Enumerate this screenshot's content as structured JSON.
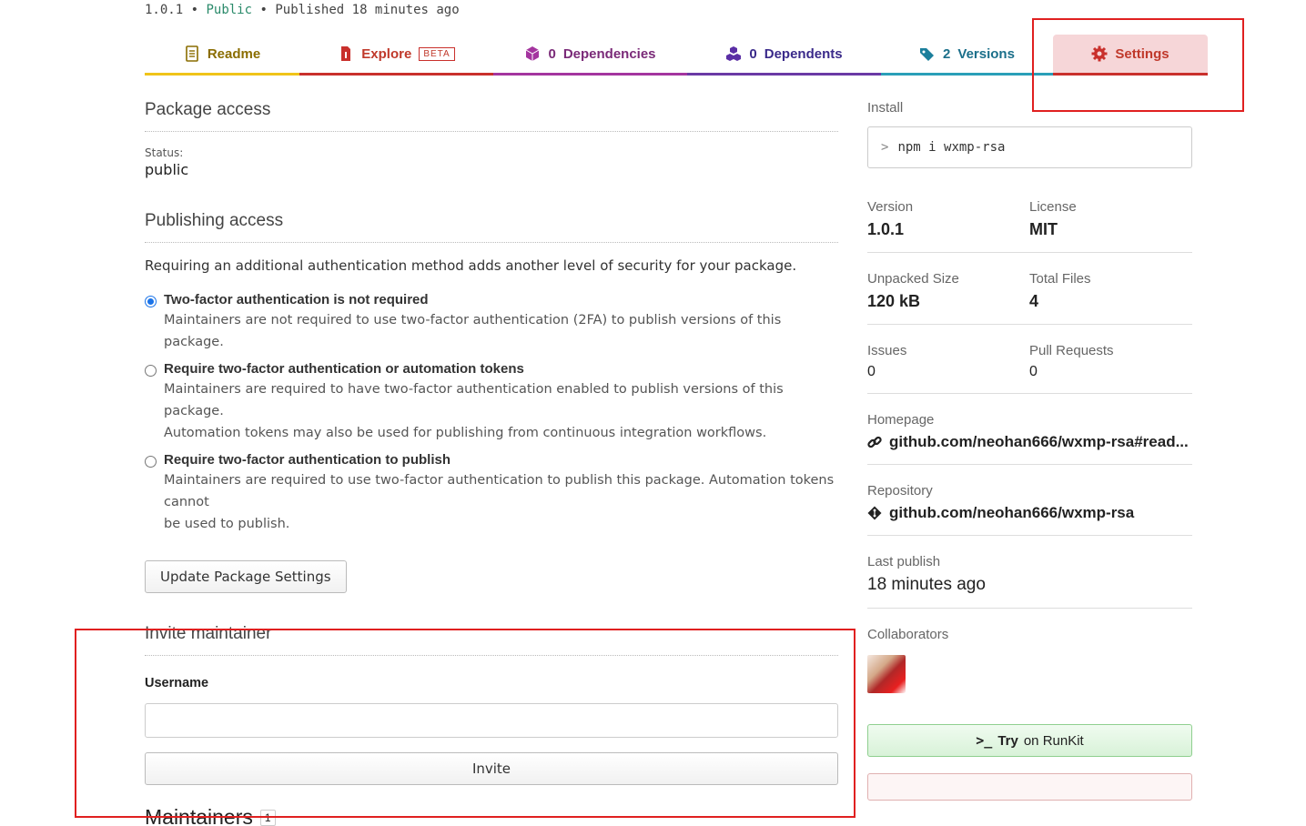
{
  "meta": {
    "version": "1.0.1",
    "visibility": "Public",
    "published": "Published 18 minutes ago",
    "sep": "•"
  },
  "tabs": {
    "readme": {
      "label": "Readme",
      "icon": "readme-icon"
    },
    "explore": {
      "label": "Explore",
      "badge": "BETA",
      "icon": "explore-icon"
    },
    "dependencies": {
      "count": "0",
      "label": "Dependencies",
      "icon": "box-icon"
    },
    "dependents": {
      "count": "0",
      "label": "Dependents",
      "icon": "boxes-icon"
    },
    "versions": {
      "count": "2",
      "label": "Versions",
      "icon": "tags-icon"
    },
    "settings": {
      "label": "Settings",
      "icon": "gear-icon"
    }
  },
  "package_access": {
    "title": "Package access",
    "status_label": "Status:",
    "status_value": "public"
  },
  "publishing_access": {
    "title": "Publishing access",
    "description": "Requiring an additional authentication method adds another level of security for your package.",
    "options": [
      {
        "title": "Two-factor authentication is not required",
        "desc": "Maintainers are not required to use two-factor authentication (2FA) to publish versions of this package.",
        "checked": true
      },
      {
        "title": "Require two-factor authentication or automation tokens",
        "desc": "Maintainers are required to have two-factor authentication enabled to publish versions of this package.",
        "desc2": "Automation tokens may also be used for publishing from continuous integration workflows.",
        "checked": false
      },
      {
        "title": "Require two-factor authentication to publish",
        "desc": "Maintainers are required to use two-factor authentication to publish this package. Automation tokens cannot",
        "desc2": "be used to publish.",
        "checked": false
      }
    ],
    "update_button": "Update Package Settings"
  },
  "invite": {
    "title": "Invite maintainer",
    "username_label": "Username",
    "username_value": "",
    "invite_button": "Invite"
  },
  "maintainers": {
    "title": "Maintainers",
    "count": "1"
  },
  "sidebar": {
    "install_label": "Install",
    "install_prompt": ">",
    "install_cmd": "npm i wxmp-rsa",
    "version_label": "Version",
    "version": "1.0.1",
    "license_label": "License",
    "license": "MIT",
    "size_label": "Unpacked Size",
    "size": "120 kB",
    "files_label": "Total Files",
    "files": "4",
    "issues_label": "Issues",
    "issues": "0",
    "prs_label": "Pull Requests",
    "prs": "0",
    "homepage_label": "Homepage",
    "homepage": "github.com/neohan666/wxmp-rsa#read...",
    "repo_label": "Repository",
    "repo": "github.com/neohan666/wxmp-rsa",
    "last_publish_label": "Last publish",
    "last_publish": "18 minutes ago",
    "collaborators_label": "Collaborators",
    "runkit_try": "Try",
    "runkit_on": "on RunKit"
  }
}
